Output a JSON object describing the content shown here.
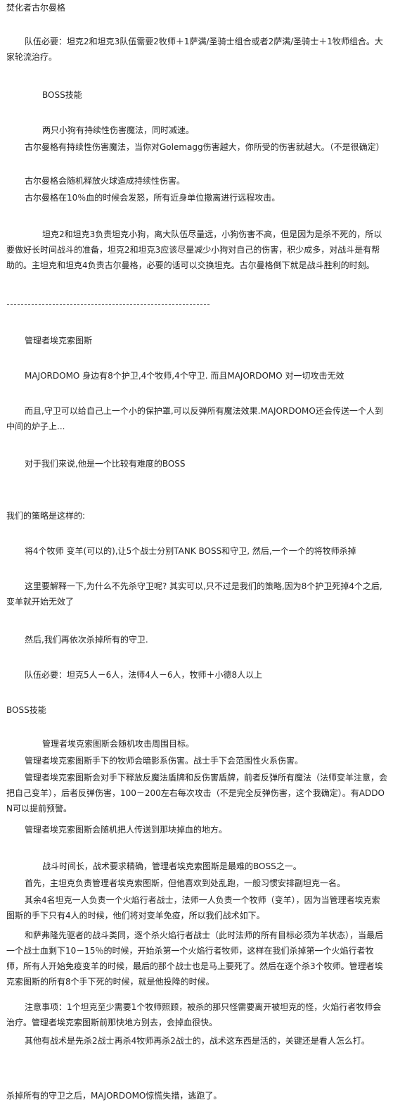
{
  "title": "焚化者古尔曼格",
  "golemagg": {
    "team_required": "队伍必要：坦克2和坦克3队伍需要2牧师＋1萨满/圣骑士组合或者2萨满/圣骑士＋1牧师组合。大家轮流治疗。",
    "boss_skills_heading": "BOSS技能",
    "skills": [
      "两只小狗有持续性伤害魔法，同时减速。",
      "古尔曼格有持续性伤害魔法，当你对Golemagg伤害越大，你所受的伤害就越大。（不是很确定）",
      "古尔曼格会随机释放火球造成持续性伤害。",
      "古尔曼格在10％血的时候会发怒，所有近身单位撤离进行远程攻击。"
    ],
    "strategy": "坦克2和坦克3负责坦克小狗，离大队伍尽量远，小狗伤害不高，但是因为是杀不死的，所以要做好长时间战斗的准备，坦克2和坦克3应该尽量减少小狗对自己的伤害，积少成多，对战斗是有帮助的。主坦克和坦克4负责古尔曼格，必要的话可以交换坦克。古尔曼格倒下就是战斗胜利的时刻。"
  },
  "separator": "-------------------------------------------------",
  "majordomo": {
    "title": "管理者埃克索图斯",
    "p1": "MAJORDOMO 身边有8个护卫,4个牧师,4个守卫. 而且MAJORDOMO 对一切攻击无效",
    "p2": "而且,守卫可以给自己上一个小的保护罩,可以反弹所有魔法效果.MAJORDOMO还会传送一个人到中间的炉子上...",
    "p3": "对于我们来说,他是一个比较有难度的BOSS",
    "p4": "我们的策略是这样的:",
    "p5": "将4个牧师 变羊(可以的),让5个战士分别TANK BOSS和守卫, 然后,一个一个的将牧师杀掉",
    "p6": "这里要解释一下,为什么不先杀守卫呢? 其实可以,只不过是我们的策略,因为8个护卫死掉4个之后,变羊就开始无效了",
    "p7": "然后,我们再依次杀掉所有的守卫.",
    "team_required": "队伍必要：坦克5人－6人，法师4人－6人，牧师＋小德8人以上",
    "boss_skills_heading": "BOSS技能",
    "skills": [
      "管理者埃克索图斯会随机攻击周围目标。",
      "管理者埃克索图斯手下的牧师会暗影系伤害。战士手下会范围性火系伤害。",
      "管理者埃克索图斯会对手下释放反魔法盾牌和反伤害盾牌，前者反弹所有魔法（法师变羊注意，会把自己变羊），后者反弹伤害，100－200左右每次攻击（不是完全反弹伤害，这个我确定）。有ADDON可以提前预警。",
      "管理者埃克索图斯会随机把人传送到那块掉血的地方。"
    ],
    "tactics": [
      "战斗时间长，战术要求精确，管理者埃克索图斯是最难的BOSS之一。",
      "首先，主坦克负责管理者埃克索图斯，但他喜欢到处乱跑，一般习惯安排副坦克一名。",
      "其余4名坦克一人负责一个火焰行者战士，法师一人负责一个牧师（变羊），因为当管理者埃克索图斯的手下只有4人的时候，他们将对变羊免疫，所以我们战术如下。",
      "和萨弗隆先驱者的战斗类同，逐个杀火焰行者战士（此时法师的所有目标必须为羊状态），当最后一个战士血剩下10－15％的时候，开始杀第一个火焰行者牧师，这样在我们杀掉第一个火焰行者牧师，所有人开始免疫变羊的时候，最后的那个战士也是马上要死了。然后在逐个杀3个牧师。管理者埃克索图斯的所有8个手下死的时候，就是他投降的时候。",
      "注意事项：1个坦克至少需要1个牧师照顾，被杀的那只怪需要离开被坦克的怪，火焰行者牧师会治疗。管理者埃克索图斯前那快地方别去，会掉血很快。",
      "其他有战术是先杀2战士再杀4牧师再杀2战士的，战术这东西是活的，关键还是看人怎么打。"
    ],
    "ending": "杀掉所有的守卫之后，MAJORDOMO惊慌失措，逃跑了。"
  }
}
